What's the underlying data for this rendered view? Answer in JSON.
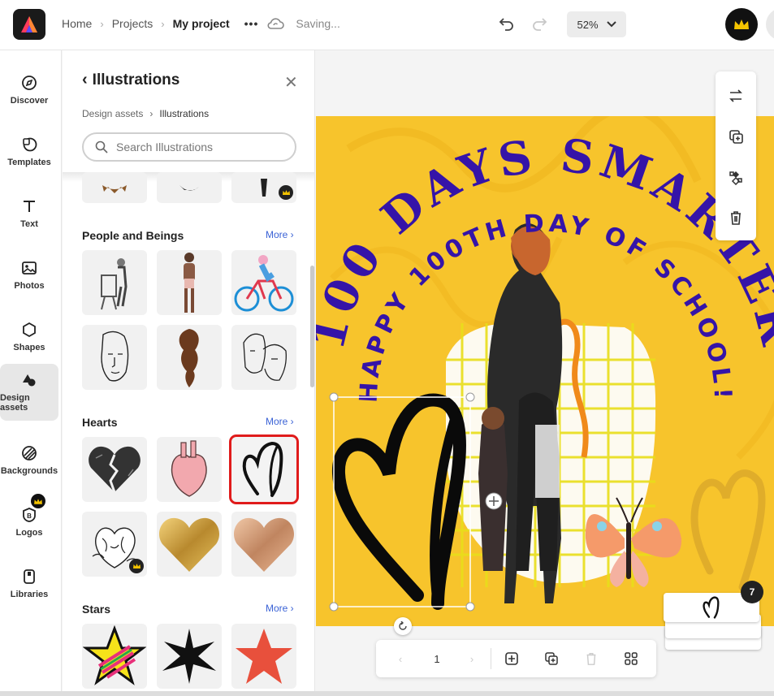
{
  "header": {
    "breadcrumbs": [
      "Home",
      "Projects",
      "My project"
    ],
    "more_label": "•••",
    "status": "Saving...",
    "zoom": "52%"
  },
  "rail": {
    "items": [
      {
        "label": "Discover",
        "icon": "compass-icon"
      },
      {
        "label": "Templates",
        "icon": "templates-icon"
      },
      {
        "label": "Text",
        "icon": "text-icon"
      },
      {
        "label": "Photos",
        "icon": "photo-icon"
      },
      {
        "label": "Shapes",
        "icon": "shapes-icon"
      },
      {
        "label": "Design assets",
        "icon": "design-assets-icon",
        "active": true
      },
      {
        "label": "Backgrounds",
        "icon": "backgrounds-icon"
      },
      {
        "label": "Logos",
        "icon": "logos-icon"
      },
      {
        "label": "Libraries",
        "icon": "libraries-icon"
      }
    ]
  },
  "panel": {
    "title": "Illustrations",
    "breadcrumbs": [
      "Design assets",
      "Illustrations"
    ],
    "search_placeholder": "Search Illustrations",
    "sections": [
      {
        "title": "People and Beings",
        "more": "More"
      },
      {
        "title": "Hearts",
        "more": "More"
      },
      {
        "title": "Stars",
        "more": "More"
      }
    ]
  },
  "canvas": {
    "headline": "100 DAYS SMARTER",
    "subline": "HAPPY 100TH DAY OF SCHOOL!",
    "background_color": "#f7c42c",
    "text_color": "#3514a8"
  },
  "pagination": {
    "current_page": "1",
    "page_count_badge": "7"
  },
  "colors": {
    "accent": "#3b63d6",
    "selection": "#e01b1b",
    "brand_dark": "#1a1a1a",
    "crown": "#f5c400"
  }
}
